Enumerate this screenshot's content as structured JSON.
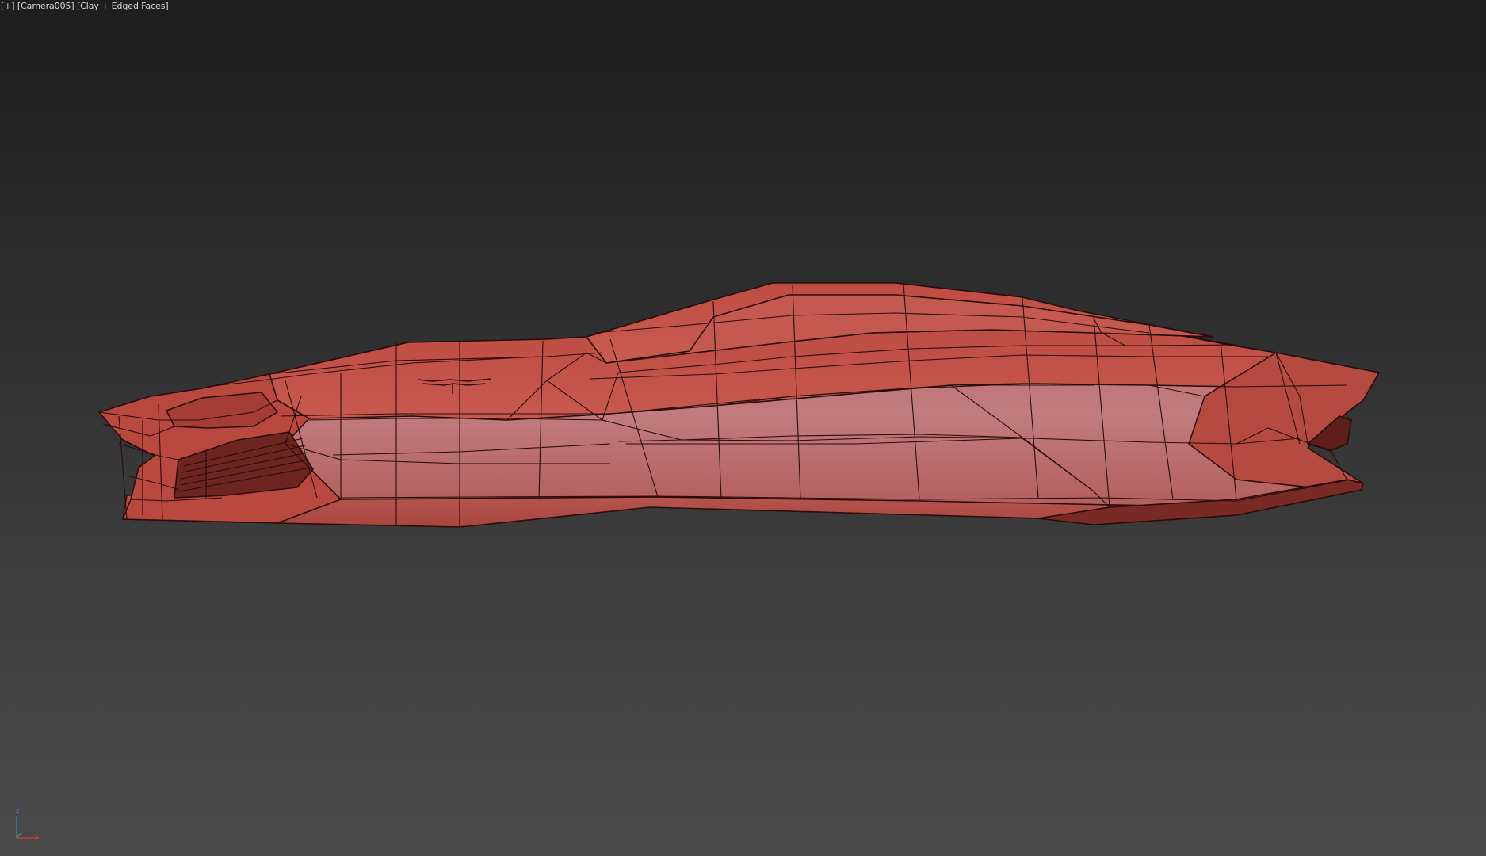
{
  "viewport": {
    "menu_label": "[+]",
    "camera_label": "[Camera005]",
    "shading_label": "[Clay + Edged Faces]"
  },
  "gizmo": {
    "z_label": "z",
    "x_color": "#d23c3c",
    "y_color": "#3cc83c",
    "z_color": "#4a7de0"
  },
  "colors": {
    "clay": "#c25046",
    "edge": "#2a0c0a"
  }
}
